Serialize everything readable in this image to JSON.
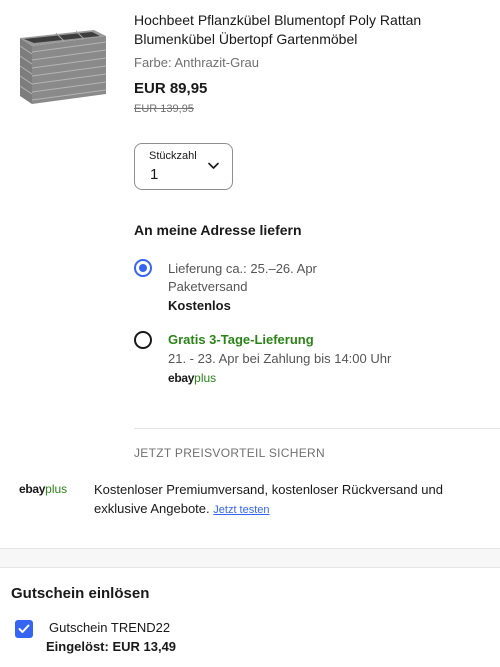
{
  "product": {
    "title": "Hochbeet Pflanzkübel Blumentopf Poly Rattan Blumenkübel Übertopf Gartenmöbel",
    "variant": "Farbe: Anthrazit-Grau",
    "price": "EUR 89,95",
    "old_price": "EUR 139,95",
    "image_icon": "rattan-planter-image"
  },
  "quantity": {
    "label": "Stückzahl",
    "value": "1",
    "icon": "chevron-down-icon"
  },
  "delivery": {
    "heading": "An meine Adresse liefern",
    "options": [
      {
        "selected": true,
        "line1": "Lieferung ca.: 25.–26. Apr",
        "line2": "Paketversand",
        "line3": "Kostenlos"
      },
      {
        "selected": false,
        "line1": "Gratis 3-Tage-Lieferung",
        "line2": "21. - 23. Apr bei Zahlung bis 14:00 Uhr",
        "logo_ebay": "ebay",
        "logo_plus": "plus"
      }
    ]
  },
  "promo": {
    "heading": "JETZT PREISVORTEIL SICHERN",
    "logo_ebay": "ebay",
    "logo_plus": "plus",
    "text": "Kostenloser Premiumversand, kostenloser Rückversand und exklusive Angebote.",
    "link": "Jetzt testen"
  },
  "voucher": {
    "heading": "Gutschein einlösen",
    "code": "Gutschein TREND22",
    "redeemed": "Eingelöst: EUR 13,49",
    "checked": true
  },
  "colors": {
    "accent_blue": "#3665f3",
    "green": "#2c8418",
    "text": "#191919",
    "muted": "#707070"
  }
}
